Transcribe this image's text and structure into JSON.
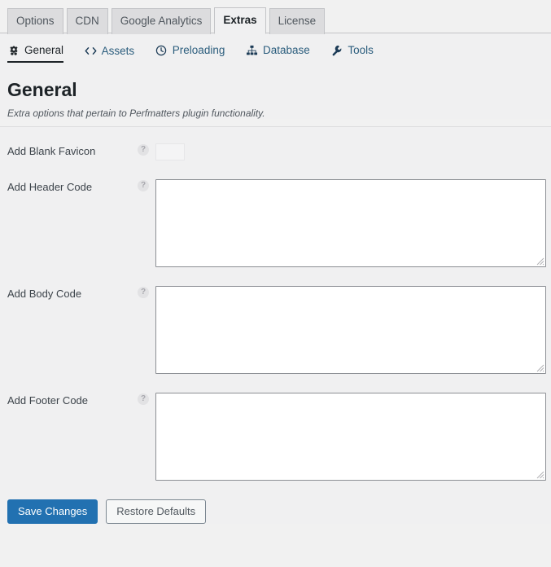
{
  "tabs": [
    {
      "label": "Options",
      "active": false
    },
    {
      "label": "CDN",
      "active": false
    },
    {
      "label": "Google Analytics",
      "active": false
    },
    {
      "label": "Extras",
      "active": true
    },
    {
      "label": "License",
      "active": false
    }
  ],
  "subnav": [
    {
      "label": "General",
      "icon": "gear-icon",
      "active": true
    },
    {
      "label": "Assets",
      "icon": "code-icon",
      "active": false
    },
    {
      "label": "Preloading",
      "icon": "clock-icon",
      "active": false
    },
    {
      "label": "Database",
      "icon": "sitemap-icon",
      "active": false
    },
    {
      "label": "Tools",
      "icon": "wrench-icon",
      "active": false
    }
  ],
  "page": {
    "title": "General",
    "description": "Extra options that pertain to Perfmatters plugin functionality."
  },
  "options": [
    {
      "label": "Add Blank Favicon",
      "help": "?",
      "type": "toggle",
      "value": "off"
    },
    {
      "label": "Add Header Code",
      "help": "?",
      "type": "textarea",
      "value": "",
      "placeholder": ""
    },
    {
      "label": "Add Body Code",
      "help": "?",
      "type": "textarea",
      "value": "",
      "placeholder": ""
    },
    {
      "label": "Add Footer Code",
      "help": "?",
      "type": "textarea",
      "value": "",
      "placeholder": ""
    }
  ],
  "actions": {
    "save_label": "Save Changes",
    "restore_label": "Restore Defaults"
  },
  "colors": {
    "primary": "#2271b1",
    "link": "#2b5d7d",
    "page_bg": "#f0f0f1",
    "text": "#3c434a",
    "heading": "#1d2327"
  }
}
